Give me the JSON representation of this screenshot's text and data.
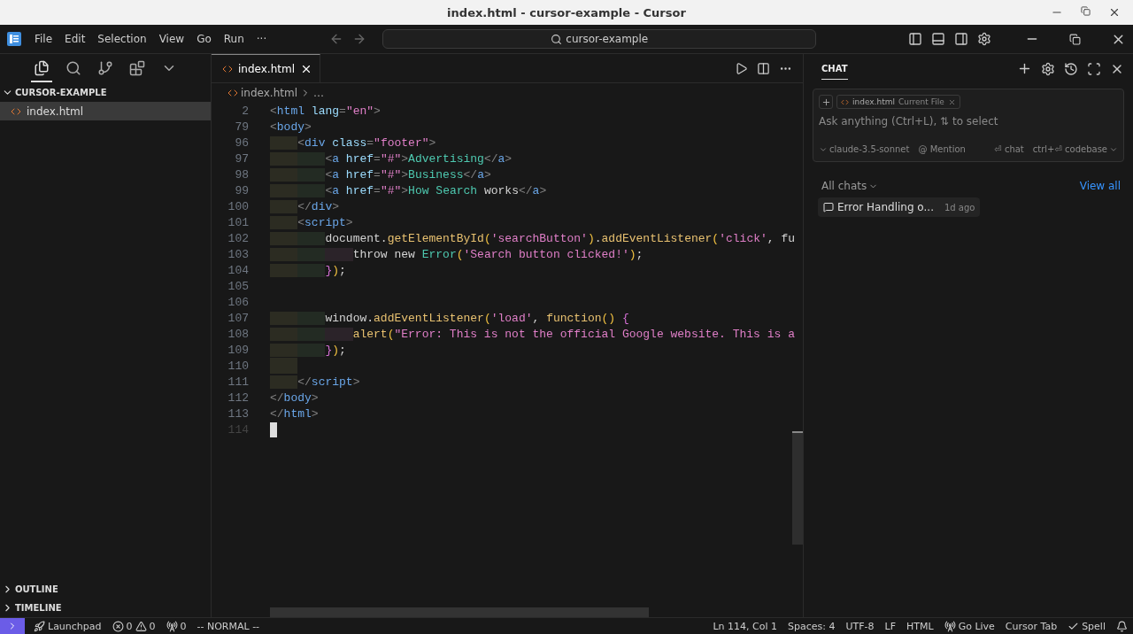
{
  "window": {
    "title": "index.html - cursor-example - Cursor"
  },
  "menu": {
    "items": [
      "File",
      "Edit",
      "Selection",
      "View",
      "Go",
      "Run",
      "···"
    ],
    "search": "cursor-example"
  },
  "activity": [
    {
      "kind": "files",
      "selected": true
    },
    {
      "kind": "search",
      "selected": false
    },
    {
      "kind": "git",
      "selected": false
    },
    {
      "kind": "extensions",
      "selected": false
    },
    {
      "kind": "more",
      "selected": false
    }
  ],
  "explorer": {
    "title": "CURSOR-EXAMPLE",
    "expanded": true,
    "files": [
      {
        "name": "index.html",
        "selected": true
      }
    ],
    "sections": [
      {
        "title": "OUTLINE",
        "expanded": false
      },
      {
        "title": "TIMELINE",
        "expanded": false
      }
    ]
  },
  "editor": {
    "tabs": [
      {
        "label": "index.html",
        "selected": true
      }
    ],
    "breadcrumb": [
      "index.html",
      "…"
    ],
    "lines": [
      {
        "number": "2",
        "current": false,
        "text": "<html lang=\"en\">"
      },
      {
        "number": "79",
        "current": false,
        "text": "<body>"
      },
      {
        "number": "96",
        "current": false,
        "text": "    <div class=\"footer\">"
      },
      {
        "number": "97",
        "current": false,
        "text": "        <a href=\"#\">Advertising</a>"
      },
      {
        "number": "98",
        "current": false,
        "text": "        <a href=\"#\">Business</a>"
      },
      {
        "number": "99",
        "current": false,
        "text": "        <a href=\"#\">How Search works</a>"
      },
      {
        "number": "100",
        "current": false,
        "text": "    </div>"
      },
      {
        "number": "101",
        "current": false,
        "text": "    <script>"
      },
      {
        "number": "102",
        "current": false,
        "text": "        document.getElementById('searchButton').addEventListener('click', fu"
      },
      {
        "number": "103",
        "current": false,
        "text": "            throw new Error('Search button clicked!');"
      },
      {
        "number": "104",
        "current": false,
        "text": "        });"
      },
      {
        "number": "105",
        "current": false
      },
      {
        "number": "106",
        "current": false
      },
      {
        "number": "107",
        "current": false,
        "text": "        window.addEventListener('load', function() {"
      },
      {
        "number": "108",
        "current": false,
        "text": "            alert(\"Error: This is not the official Google website. This is a"
      },
      {
        "number": "109",
        "current": false,
        "text": "        });"
      },
      {
        "number": "110",
        "current": false
      },
      {
        "number": "111",
        "current": false,
        "text": "    </script>"
      },
      {
        "number": "112",
        "current": false,
        "text": "</body>"
      },
      {
        "number": "113",
        "current": false,
        "text": "</html>"
      },
      {
        "number": "114",
        "current": true
      }
    ]
  },
  "chat": {
    "title": "CHAT",
    "context": {
      "file": "index.html",
      "label": "Current File"
    },
    "placeholder": "Ask anything (Ctrl+L), ⇅ to select",
    "model": "claude-3.5-sonnet",
    "mention": "@ Mention",
    "send": "⏎ chat",
    "codebase": "ctrl+⏎ codebase",
    "history_label": "All chats",
    "view_all": "View all",
    "history": [
      {
        "title": "Error Handling o...",
        "time": "1d ago"
      }
    ]
  },
  "status": {
    "left": [
      {
        "kind": "launchpad",
        "text": "Launchpad"
      },
      {
        "kind": "problems",
        "errors": "0",
        "warnings": "0"
      },
      {
        "kind": "ports",
        "text": "0"
      },
      {
        "kind": "plain",
        "text": "-- NORMAL --"
      }
    ],
    "right": [
      {
        "kind": "plain",
        "text": "Ln 114, Col 1"
      },
      {
        "kind": "plain",
        "text": "Spaces: 4"
      },
      {
        "kind": "plain",
        "text": "UTF-8"
      },
      {
        "kind": "plain",
        "text": "LF"
      },
      {
        "kind": "plain",
        "text": "HTML"
      },
      {
        "kind": "golive",
        "text": "Go Live"
      },
      {
        "kind": "plain",
        "text": "Cursor Tab"
      },
      {
        "kind": "spell",
        "text": "Spell"
      },
      {
        "kind": "bell"
      }
    ]
  }
}
